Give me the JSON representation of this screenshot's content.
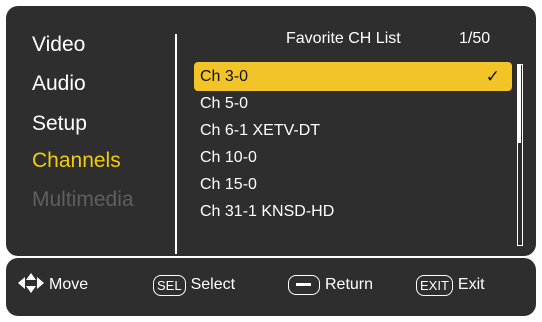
{
  "menu": {
    "items": [
      {
        "label": "Video",
        "state": "normal"
      },
      {
        "label": "Audio",
        "state": "normal"
      },
      {
        "label": "Setup",
        "state": "normal"
      },
      {
        "label": "Channels",
        "state": "active"
      },
      {
        "label": "Multimedia",
        "state": "disabled"
      }
    ]
  },
  "list": {
    "title": "Favorite CH List",
    "page": "1/50",
    "selected_mark": "✓",
    "channels": [
      {
        "label": "Ch 3-0",
        "selected": true
      },
      {
        "label": "Ch 5-0",
        "selected": false
      },
      {
        "label": "Ch 6-1 XETV-DT",
        "selected": false
      },
      {
        "label": "Ch 10-0",
        "selected": false
      },
      {
        "label": "Ch 15-0",
        "selected": false
      },
      {
        "label": "Ch 31-1 KNSD-HD",
        "selected": false
      }
    ],
    "scroll_position_fraction": 0.0
  },
  "footer": {
    "move_label": "Move",
    "select_key": "SEL",
    "select_label": "Select",
    "return_label": "Return",
    "exit_key": "EXIT",
    "exit_label": "Exit"
  },
  "colors": {
    "panel_background": "#2e2e2e",
    "active_menu_text": "#f2cc0c",
    "disabled_menu_text": "#5f5f5f",
    "selected_row_background": "#f2c428"
  },
  "icons": {
    "move": "four-way-arrows-icon",
    "return": "minus-key-icon",
    "checkmark": "checkmark-icon"
  }
}
